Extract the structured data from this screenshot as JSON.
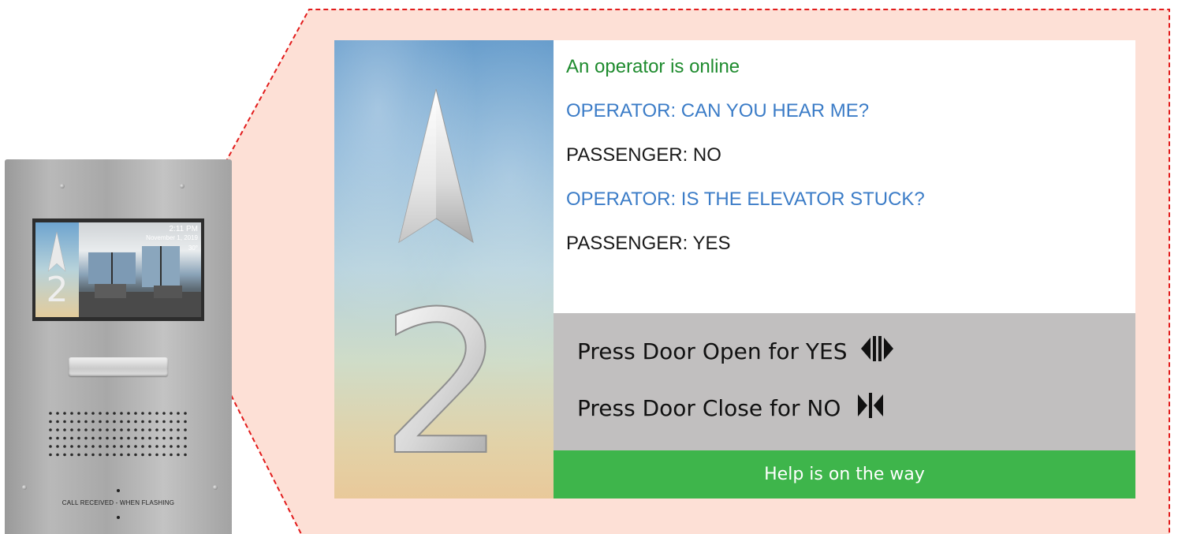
{
  "device": {
    "mini_time": "2:11 PM",
    "mini_date": "November 1, 2019",
    "mini_temp": "30°",
    "mini_floor": "2",
    "label": "CALL RECEIVED - WHEN FLASHING"
  },
  "screen": {
    "floor_number": "2",
    "floor_direction": "up-arrow-icon",
    "messages": [
      {
        "type": "status",
        "text": "An operator is online"
      },
      {
        "type": "operator",
        "text": "OPERATOR: CAN YOU HEAR ME?"
      },
      {
        "type": "passenger",
        "text": "PASSENGER: NO"
      },
      {
        "type": "operator",
        "text": "OPERATOR: IS THE ELEVATOR STUCK?"
      },
      {
        "type": "passenger",
        "text": "PASSENGER: YES"
      }
    ],
    "prompts": {
      "yes": "Press Door Open for YES",
      "no": "Press Door Close for NO"
    },
    "status_bar": "Help is on the way"
  },
  "colors": {
    "callout_fill": "#fde0d6",
    "callout_border": "#e21b1b",
    "online_text": "#1e8b2e",
    "operator_text": "#3b7cc7",
    "passenger_text": "#1a1a1a",
    "prompt_panel": "#c1bfbf",
    "status_bar": "#3eb54b"
  },
  "icons": {
    "door_open": "door-open-icon",
    "door_close": "door-close-icon"
  }
}
